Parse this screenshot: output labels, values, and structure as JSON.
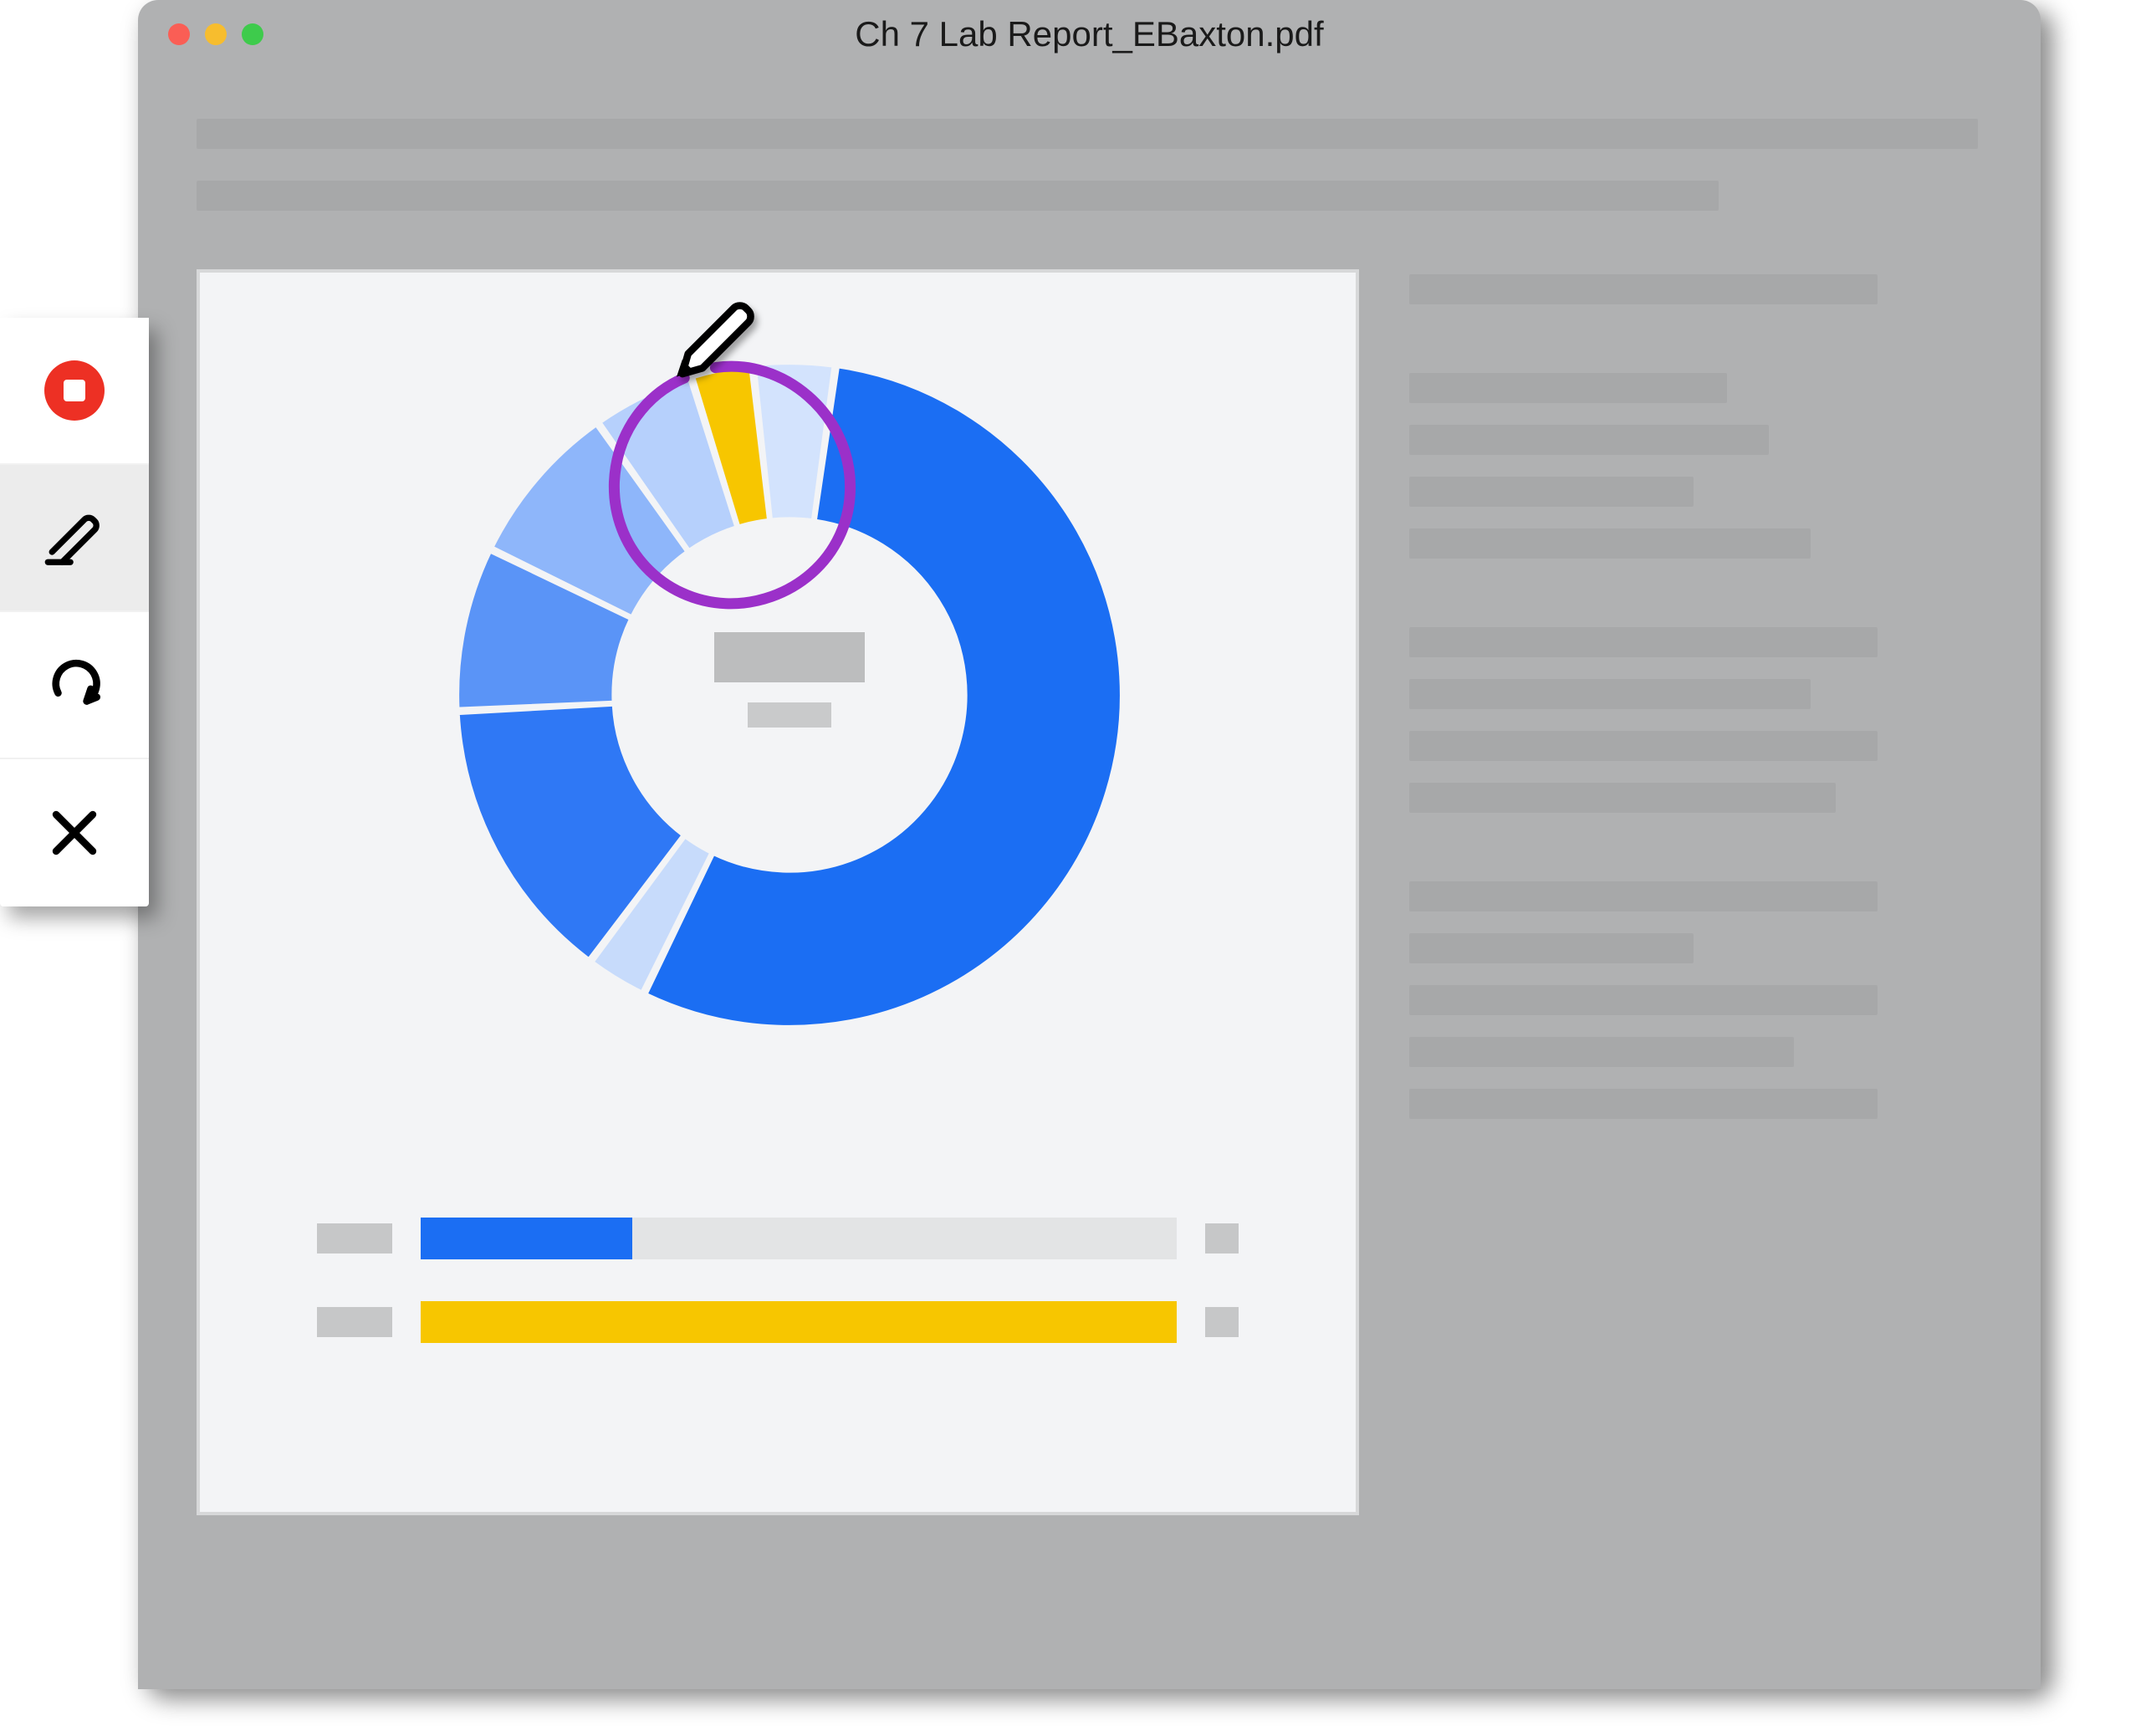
{
  "window": {
    "title": "Ch 7 Lab Report_EBaxton.pdf",
    "traffic_lights": {
      "red": "close",
      "yellow": "minimize",
      "green": "maximize"
    }
  },
  "toolbar": {
    "items": [
      {
        "name": "record-stop",
        "icon": "record-stop-icon"
      },
      {
        "name": "draw",
        "icon": "pencil-icon",
        "selected": true
      },
      {
        "name": "redo",
        "icon": "redo-arrow-icon"
      },
      {
        "name": "cancel",
        "icon": "close-x-icon"
      }
    ]
  },
  "annotation": {
    "stroke_color": "#9b30c9",
    "cursor": "pencil"
  },
  "chart_data": {
    "type": "pie",
    "layout": "donut",
    "series": [
      {
        "name": "segment-1-dark-blue",
        "value": 55,
        "color": "#1b6ef3"
      },
      {
        "name": "segment-2-light-blue",
        "value": 3,
        "color": "#c7dbfb"
      },
      {
        "name": "segment-3-blue",
        "value": 14,
        "color": "#2f78f5"
      },
      {
        "name": "segment-4-mid-blue",
        "value": 8,
        "color": "#5a94f7"
      },
      {
        "name": "segment-5-pale-blue",
        "value": 8,
        "color": "#8eb6fa"
      },
      {
        "name": "segment-6-lighter-blue",
        "value": 5,
        "color": "#b6d0fc"
      },
      {
        "name": "segment-7-yellow",
        "value": 3,
        "color": "#f7c600"
      },
      {
        "name": "segment-8-lightest-blue",
        "value": 4,
        "color": "#d3e3fd"
      }
    ],
    "title": "",
    "center_label_primary": "",
    "center_label_secondary": ""
  },
  "progress": {
    "rows": [
      {
        "label": "",
        "fill_percent": 28,
        "color": "#1b6ef3",
        "end_label": ""
      },
      {
        "label": "",
        "fill_percent": 100,
        "color": "#f7c600",
        "end_label": ""
      }
    ]
  },
  "sidebar_lines": {
    "groups": [
      {
        "widths": [
          560
        ]
      },
      {
        "widths": [
          380,
          430,
          340,
          480
        ]
      },
      {
        "widths": [
          560,
          480,
          560,
          510
        ]
      },
      {
        "widths": [
          560,
          340,
          560,
          460,
          560
        ]
      }
    ]
  }
}
